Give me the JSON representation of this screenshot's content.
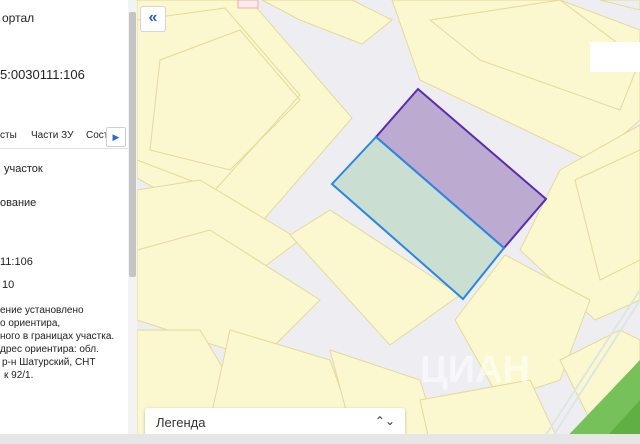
{
  "panel": {
    "title": "ортал",
    "cadastral_number": "5:0030111:106",
    "tabs": [
      "сты",
      "Части ЗУ",
      "Соста"
    ],
    "object_type": "участок",
    "status_partial": "ование",
    "number_partial": "11:106",
    "value_partial": "10",
    "address_lines": [
      "ение установлено",
      "о ориентира,",
      "ного в границах участка.",
      "дрес ориентира: обл.",
      "р-н Шатурский, СНТ",
      "к 92/1."
    ]
  },
  "map": {
    "collapse_icon": "«",
    "watermark": "ЦИАН"
  },
  "legend": {
    "label": "Легенда",
    "icon": "⌃⌄"
  },
  "colors": {
    "parcel_bg": "#fbf7cf",
    "parcel_stroke": "#e5d99a",
    "road": "#eeeef2",
    "highlight_purple_fill": "#b8a5cf",
    "highlight_purple_stroke": "#5b2bb5",
    "highlight_teal_fill": "#c7dccf",
    "highlight_teal_stroke": "#2a88e0"
  }
}
